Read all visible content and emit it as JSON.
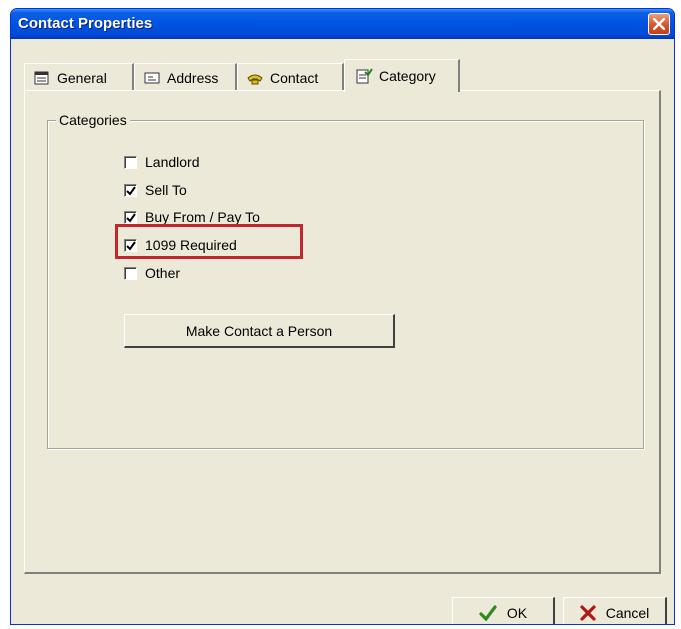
{
  "window": {
    "title": "Contact Properties"
  },
  "tabs": [
    {
      "label": "General",
      "icon": "property-sheet-icon"
    },
    {
      "label": "Address",
      "icon": "card-icon"
    },
    {
      "label": "Contact",
      "icon": "telephone-icon"
    },
    {
      "label": "Category",
      "icon": "checklist-icon",
      "active": true
    }
  ],
  "categories": {
    "label": "Categories",
    "items": [
      {
        "label": "Landlord",
        "checked": false
      },
      {
        "label": "Sell To",
        "checked": true
      },
      {
        "label": "Buy From / Pay To",
        "checked": true
      },
      {
        "label": "1099 Required",
        "checked": true,
        "highlighted": true
      },
      {
        "label": "Other",
        "checked": false
      }
    ]
  },
  "buttons": {
    "make_person": "Make Contact a Person",
    "ok": "OK",
    "cancel": "Cancel"
  },
  "colors": {
    "titlebar": "#0054e3",
    "highlight": "#c0282d",
    "ok_check": "#2e8b1e",
    "cancel_x": "#b01818"
  }
}
